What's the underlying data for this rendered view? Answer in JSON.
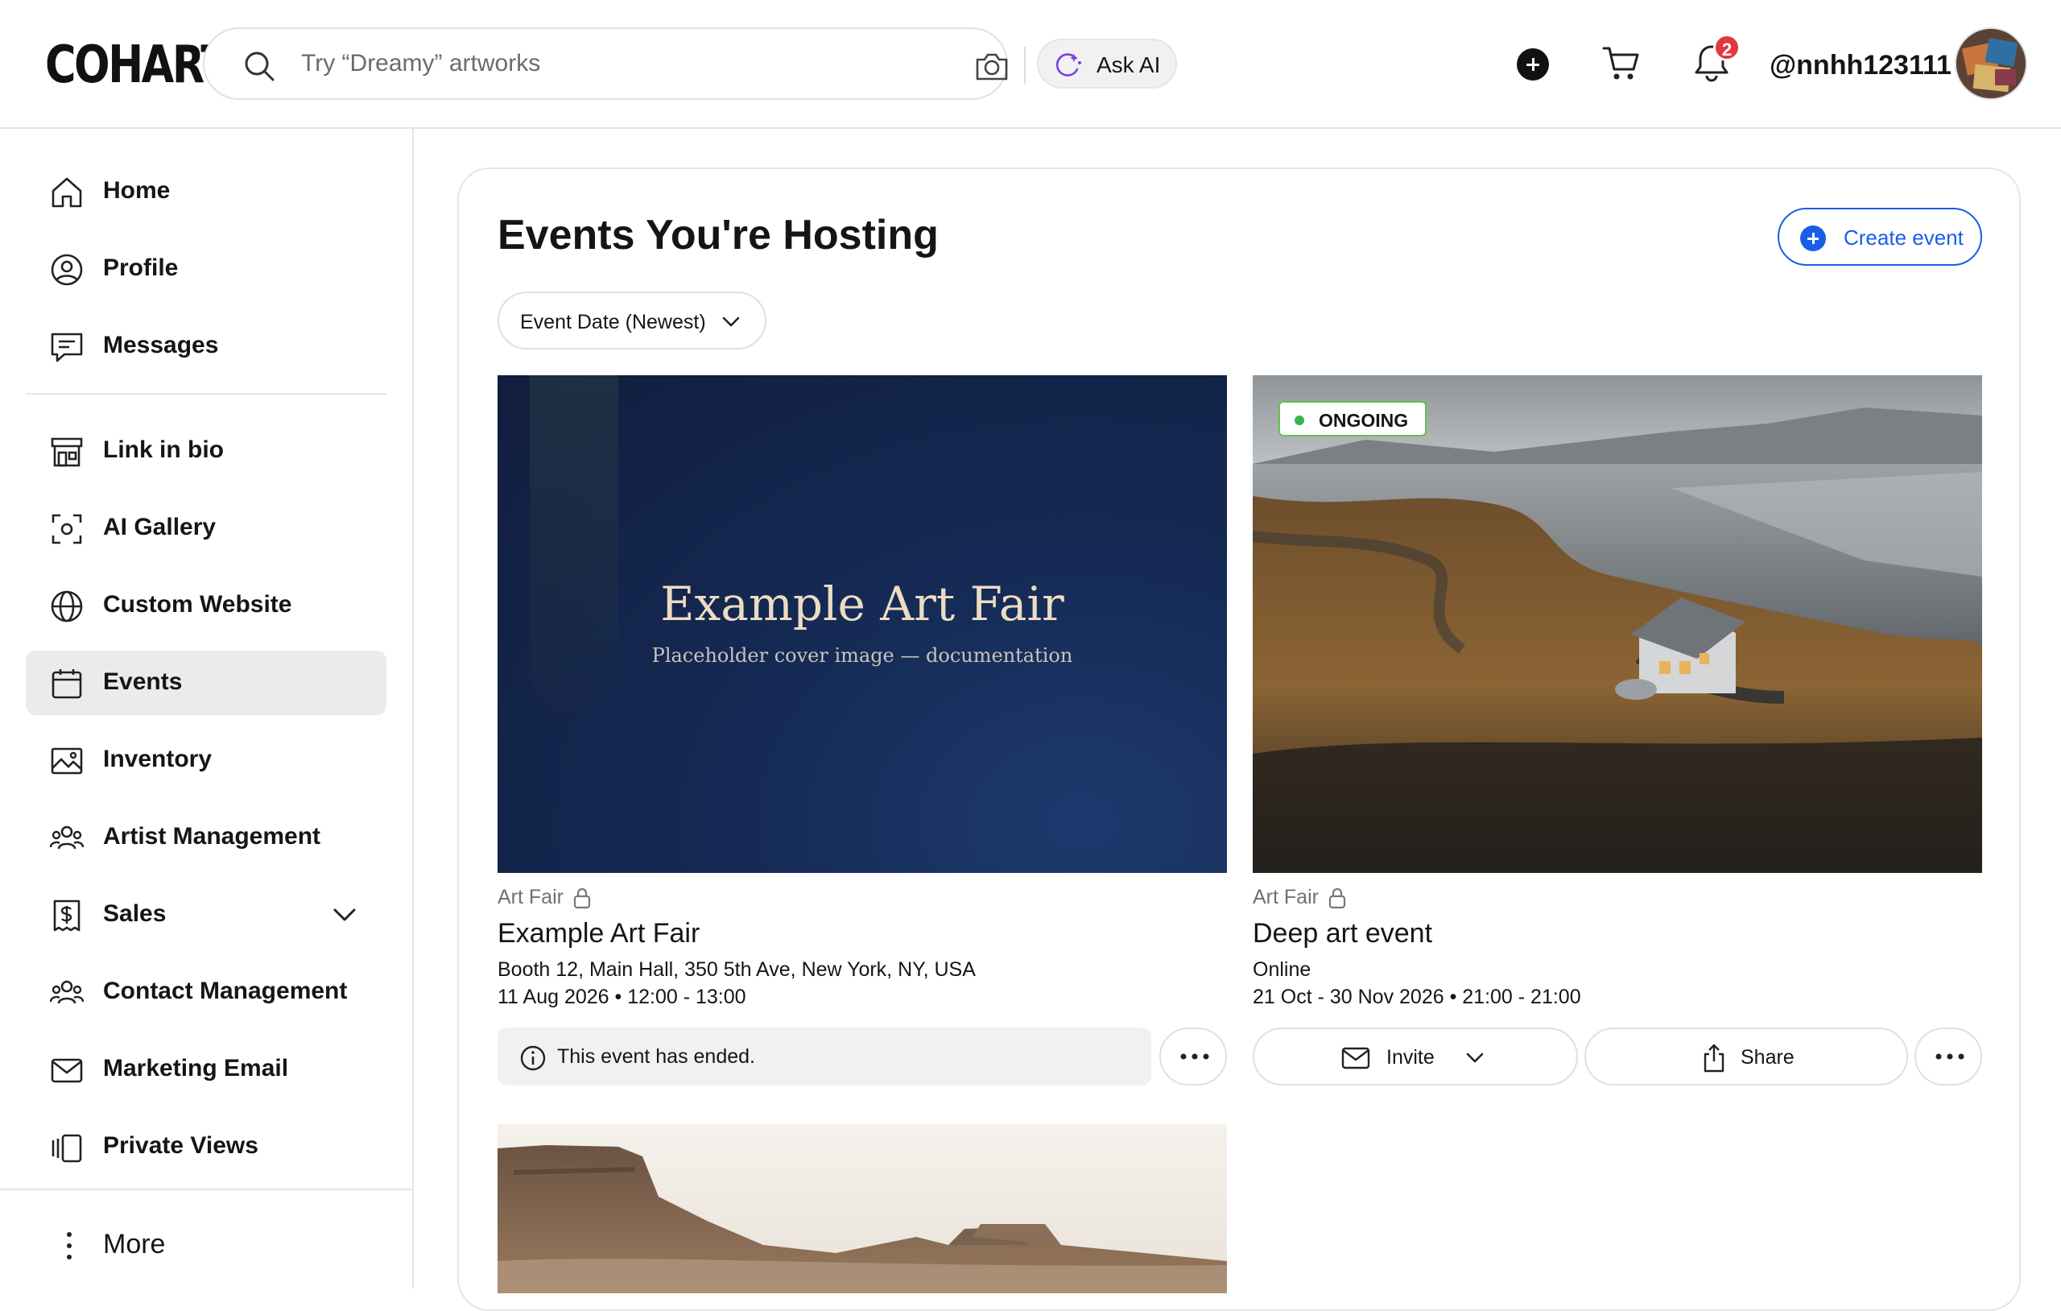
{
  "header": {
    "logo": "COHART",
    "search_placeholder": "Try “Dreamy” artworks",
    "ask_ai": "Ask AI",
    "notification_count": "2",
    "username": "@nnhh123111"
  },
  "sidebar": {
    "items": [
      {
        "label": "Home",
        "icon": "home-icon"
      },
      {
        "label": "Profile",
        "icon": "profile-icon"
      },
      {
        "label": "Messages",
        "icon": "messages-icon"
      },
      {
        "label": "Link in bio",
        "icon": "storefront-icon"
      },
      {
        "label": "AI Gallery",
        "icon": "scan-icon"
      },
      {
        "label": "Custom Website",
        "icon": "globe-icon"
      },
      {
        "label": "Events",
        "icon": "calendar-icon",
        "active": true
      },
      {
        "label": "Inventory",
        "icon": "image-icon"
      },
      {
        "label": "Artist Management",
        "icon": "people-icon"
      },
      {
        "label": "Sales",
        "icon": "dollar-icon"
      },
      {
        "label": "Contact Management",
        "icon": "people-icon"
      },
      {
        "label": "Marketing Email",
        "icon": "mail-icon"
      },
      {
        "label": "Private Views",
        "icon": "private-views-icon"
      }
    ],
    "more_label": "More"
  },
  "main": {
    "title": "Events You're Hosting",
    "create_label": "Create event",
    "sort_label": "Event Date (Newest)",
    "events": [
      {
        "cover_title": "Example Art Fair",
        "cover_subtitle": "Placeholder cover image — documentation",
        "category": "Art Fair",
        "title": "Example Art Fair",
        "location": "Booth 12, Main Hall, 350 5th Ave, New York, NY, USA",
        "datetime": "11 Aug 2026 • 12:00 - 13:00",
        "status_message": "This event has ended."
      },
      {
        "badge": "ONGOING",
        "category": "Art Fair",
        "title": "Deep art event",
        "location": "Online",
        "datetime": "21 Oct - 30 Nov 2026 • 21:00 - 21:00",
        "invite_label": "Invite",
        "share_label": "Share"
      }
    ]
  },
  "colors": {
    "accent": "#1a5ee6",
    "badge_red": "#e4393c",
    "ongoing_green": "#3bb54a",
    "active_nav_bg": "#ebebeb"
  }
}
